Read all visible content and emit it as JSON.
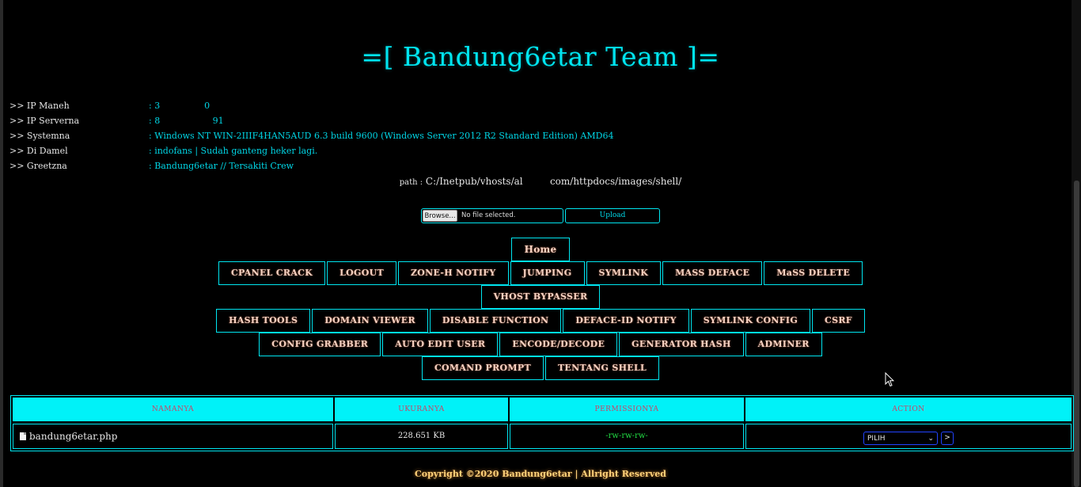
{
  "header": {
    "title": "=[ Bandung6etar Team ]="
  },
  "info": [
    {
      "label": ">> IP Maneh",
      "value": ": 3                0"
    },
    {
      "label": ">> IP Serverna",
      "value": ": 8                   91"
    },
    {
      "label": ">> Systemna",
      "value": ": Windows NT WIN-2IIIF4HAN5AUD 6.3 build 9600 (Windows Server 2012 R2 Standard Edition) AMD64"
    },
    {
      "label": ">> Di Damel",
      "value": ": indofans | Sudah ganteng heker lagi."
    },
    {
      "label": ">> Greetzna",
      "value": ": Bandung6etar // Tersakiti Crew"
    }
  ],
  "path": {
    "label": "path :",
    "value": "C:/Inetpub/vhosts/al         com/httpdocs/images/shell/"
  },
  "upload": {
    "browse_label": "Browse...",
    "file_status": "No file selected.",
    "upload_label": "Upload"
  },
  "menu": {
    "row1": [
      "Home"
    ],
    "row2": [
      "CPANEL CRACK",
      "LOGOUT",
      "ZONE-H NOTIFY",
      "JUMPING",
      "SYMLINK",
      "MASS DEFACE",
      "MaSS DELETE"
    ],
    "row3": [
      "VHOST BYPASSER"
    ],
    "row4": [
      "HASH TOOLS",
      "DOMAIN VIEWER",
      "DISABLE FUNCTION",
      "DEFACE-ID NOTIFY",
      "SYMLINK CONFIG",
      "CSRF"
    ],
    "row5": [
      "CONFIG GRABBER",
      "AUTO EDIT USER",
      "ENCODE/DECODE",
      "GENERATOR HASH",
      "ADMINER"
    ],
    "row6": [
      "COMAND PROMPT",
      "TENTANG SHELL"
    ]
  },
  "table": {
    "headers": [
      "NAMANYA",
      "UKURANYA",
      "PERMISSIONYA",
      "ACTION"
    ],
    "rows": [
      {
        "name": "bandung6etar.php",
        "size": "228.651 KB",
        "perm": "-rw-rw-rw-",
        "action_select": "PILIH",
        "go_label": ">"
      }
    ]
  },
  "footer": {
    "text": "Copyright ©2020 Bandung6etar | Allright Reserved"
  },
  "colors": {
    "accent": "#00e5f0",
    "header_bg": "#00f2f8",
    "menu_text": "#f5d2c2",
    "footer": "#ffd27a",
    "perm": "#22dd44"
  },
  "icons": [
    "file-icon",
    "chevron-down-icon",
    "cursor-icon"
  ]
}
